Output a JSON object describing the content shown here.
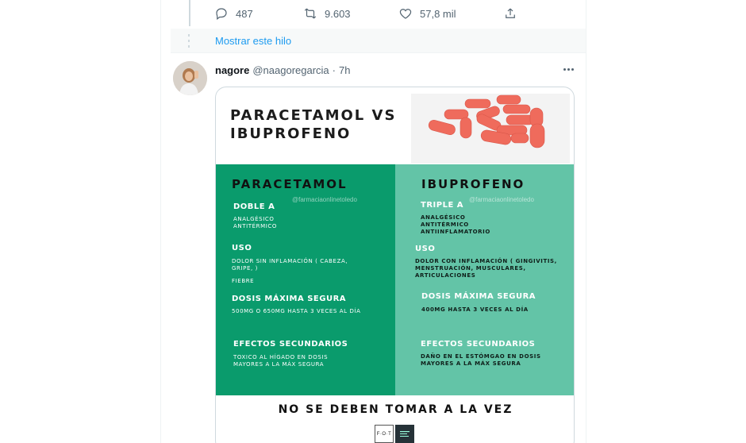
{
  "actions": {
    "replies": "487",
    "retweets": "9.603",
    "likes": "57,8 mil"
  },
  "thread": {
    "show_thread": "Mostrar este hilo"
  },
  "tweet": {
    "name": "nagore",
    "handle": "@naagoregarcia",
    "separator": "·",
    "time": "7h"
  },
  "infographic": {
    "title_line1": "PARACETAMOL VS",
    "title_line2": "IBUPROFENO",
    "watermark": "@farmaciaonlinetoledo",
    "left": {
      "heading": "PARACETAMOL",
      "type_head": "DOBLE A",
      "type_lines": [
        "ANALGÉSICO",
        "ANTITÉRMICO"
      ],
      "use_head": "USO",
      "use_lines": [
        "DOLOR SIN INFLAMACIÓN ( CABEZA,",
        "GRIPE, )"
      ],
      "use_extra": "FIEBRE",
      "dose_head": "DOSIS MÁXIMA SEGURA",
      "dose_text": "500MG O 650MG HASTA 3 VECES AL DÍA",
      "effects_head": "EFECTOS SECUNDARIOS",
      "effects_lines": [
        "TOXICO AL HÍGADO EN DOSIS",
        "MAYORES A LA MÁX SEGURA"
      ]
    },
    "right": {
      "heading": "IBUPROFENO",
      "type_head": "TRIPLE A",
      "type_lines": [
        "ANALGÉSICO",
        "ANTITÉRMICO",
        "ANTIINFLAMATORIO"
      ],
      "use_head": "USO",
      "use_lines": [
        "DOLOR CON INFLAMACIÓN ( GINGIVITIS,",
        "MENSTRUACIÓN, MUSCULARES,",
        "ARTICULACIONES"
      ],
      "dose_head": "DOSIS MÁXIMA SEGURA",
      "dose_text": "400MG HASTA 3 VECES AL DÍA",
      "effects_head": "EFECTOS SECUNDARIOS",
      "effects_lines": [
        "DAÑO EN EL ESTÓMGAO EN DOSIS",
        "MAYORES A LA MÁX SEGURA"
      ]
    },
    "bottom_note": "NO SE DEBEN TOMAR A LA VEZ",
    "logo_text": "F·O·T"
  },
  "colors": {
    "accent": "#1d9bf0",
    "panel_left": "#0a9b6c",
    "panel_right": "#63c4a7",
    "pill": "#ef6b5c"
  },
  "icons": [
    "reply-icon",
    "retweet-icon",
    "like-icon",
    "share-icon",
    "more-icon"
  ]
}
